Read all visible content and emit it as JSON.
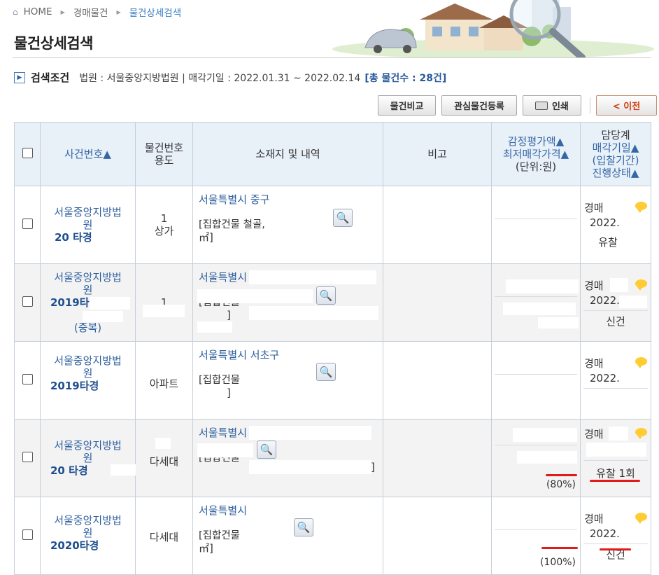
{
  "breadcrumb": {
    "home": "HOME",
    "level1": "경매물건",
    "current": "물건상세검색"
  },
  "page_title": "물건상세검색",
  "criteria": {
    "label": "검색조건",
    "text": "법원 : 서울중앙지방법원 | 매각기일 : 2022.01.31 ~ 2022.02.14",
    "count": "[총 물건수 : 28건]"
  },
  "toolbar": {
    "compare": "물건비교",
    "favorite": "관심물건등록",
    "print": "인쇄",
    "prev": "< 이전"
  },
  "table": {
    "headers": {
      "case_no": "사건번호▲",
      "item_no_1": "물건번호",
      "item_no_2": "용도",
      "location": "소재지 및 내역",
      "remark": "비고",
      "price_1": "감정평가액▲",
      "price_2": "최저매각가격▲",
      "price_3": "(단위:원)",
      "status_1": "담당계",
      "status_2": "매각기일▲",
      "status_3": "(입찰기간)",
      "status_4": "진행상태▲"
    },
    "rows": [
      {
        "court": "서울중앙지방법원",
        "case_no": "20 타경",
        "extra": "",
        "item_no": "1",
        "use": "상가",
        "address": "서울특별시 중구",
        "detail": "[집합건물 철골,",
        "detail2": "㎡]",
        "percent": "",
        "status1": "경매",
        "status2": "2022.",
        "status3": "유찰"
      },
      {
        "court": "서울중앙지방법원",
        "case_no": "2019타경",
        "extra": "(중복)",
        "item_no": "1",
        "use": "",
        "address": "서울특별시",
        "detail": "[집합건물",
        "detail2": "]",
        "percent": "",
        "status1": "경매",
        "status2": "2022.",
        "status3": "신건"
      },
      {
        "court": "서울중앙지방법원",
        "case_no": "2019타경",
        "extra": "",
        "item_no": "",
        "use": "아파트",
        "address": "서울특별시 서초구",
        "detail": "[집합건물",
        "detail2": "]",
        "percent": "",
        "status1": "경매",
        "status2": "2022.",
        "status3": ""
      },
      {
        "court": "서울중앙지방법원",
        "case_no": "20 타경",
        "extra": "",
        "item_no": "",
        "use": "다세대",
        "address": "서울특별시",
        "detail": "[집합건물",
        "detail2": "]",
        "percent": "(80%)",
        "status1": "경매",
        "status2": "",
        "status3": "유찰 1회"
      },
      {
        "court": "서울중앙지방법원",
        "case_no": "2020타경",
        "extra": "",
        "item_no": "",
        "use": "다세대",
        "address": "서울특별시",
        "detail": "[집합건물",
        "detail2": "㎡]",
        "percent": "(100%)",
        "status1": "경매",
        "status2": "2022.",
        "status3": "신건"
      }
    ]
  }
}
